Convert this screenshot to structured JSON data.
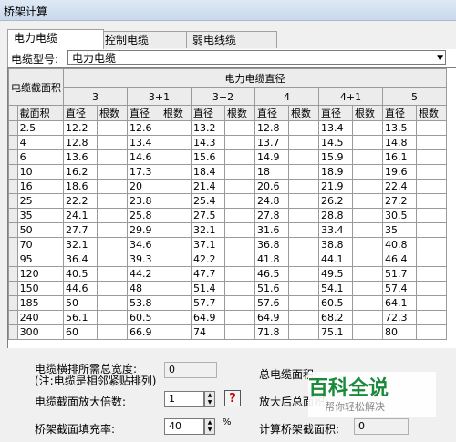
{
  "window": {
    "title": "桥架计算"
  },
  "tabs": [
    {
      "label": "电力电缆",
      "active": true
    },
    {
      "label": "控制电缆",
      "active": false
    },
    {
      "label": "弱电线缆",
      "active": false
    }
  ],
  "cable_type": {
    "label": "电缆型号:",
    "value": "电力电缆"
  },
  "grid": {
    "corner_label": "电缆截面积",
    "group_label": "电力电缆直径",
    "groups": [
      "3",
      "3+1",
      "3+2",
      "4",
      "4+1",
      "5"
    ],
    "col_section": "截面积",
    "col_diameter": "直径",
    "col_count": "根数",
    "rows": [
      {
        "section": "2.5",
        "d": [
          "12.2",
          "12.6",
          "13.2",
          "12.8",
          "13.4",
          "13.5"
        ]
      },
      {
        "section": "4",
        "d": [
          "12.8",
          "13.4",
          "14.3",
          "13.7",
          "14.5",
          "14.8"
        ]
      },
      {
        "section": "6",
        "d": [
          "13.6",
          "14.6",
          "15.6",
          "14.9",
          "15.9",
          "16.1"
        ]
      },
      {
        "section": "10",
        "d": [
          "16.2",
          "17.3",
          "18.4",
          "18",
          "18.9",
          "19.6"
        ]
      },
      {
        "section": "16",
        "d": [
          "18.6",
          "20",
          "21.4",
          "20.6",
          "21.9",
          "22.4"
        ]
      },
      {
        "section": "25",
        "d": [
          "22.2",
          "23.8",
          "25.4",
          "24.8",
          "26.2",
          "27.2"
        ]
      },
      {
        "section": "35",
        "d": [
          "24.1",
          "25.8",
          "27.5",
          "27.8",
          "28.8",
          "30.5"
        ]
      },
      {
        "section": "50",
        "d": [
          "27.7",
          "29.9",
          "32.1",
          "31.6",
          "33.4",
          "35"
        ]
      },
      {
        "section": "70",
        "d": [
          "32.1",
          "34.6",
          "37.1",
          "36.8",
          "38.8",
          "40.8"
        ]
      },
      {
        "section": "95",
        "d": [
          "36.4",
          "39.3",
          "42.2",
          "41.8",
          "44.1",
          "46.4"
        ]
      },
      {
        "section": "120",
        "d": [
          "40.5",
          "44.2",
          "47.7",
          "46.5",
          "49.5",
          "51.7"
        ]
      },
      {
        "section": "150",
        "d": [
          "44.6",
          "48",
          "51.4",
          "51.6",
          "54.1",
          "57.4"
        ]
      },
      {
        "section": "185",
        "d": [
          "50",
          "53.8",
          "57.7",
          "57.6",
          "60.5",
          "64.1"
        ]
      },
      {
        "section": "240",
        "d": [
          "56.1",
          "60.5",
          "64.9",
          "64.9",
          "68.2",
          "72.3"
        ]
      },
      {
        "section": "300",
        "d": [
          "60",
          "66.9",
          "74",
          "71.8",
          "75.1",
          "80"
        ]
      }
    ]
  },
  "bottom": {
    "width_label": "电缆横排所需总宽度:",
    "width_note": "(注:电缆是相邻紧贴排列)",
    "width_value": "0",
    "total_area_label": "总电缆面积:",
    "magnify_label": "电缆截面放大倍数:",
    "magnify_value": "1",
    "help": "?",
    "after_area_label": "放大后总面积:",
    "fill_label": "桥架截面填充率:",
    "fill_value": "40",
    "fill_unit": "%",
    "tray_area_label": "计算桥架截面积:",
    "tray_area_value": "0"
  },
  "watermark": {
    "title": "百科全说",
    "subtitle": "帮你轻松解决"
  }
}
